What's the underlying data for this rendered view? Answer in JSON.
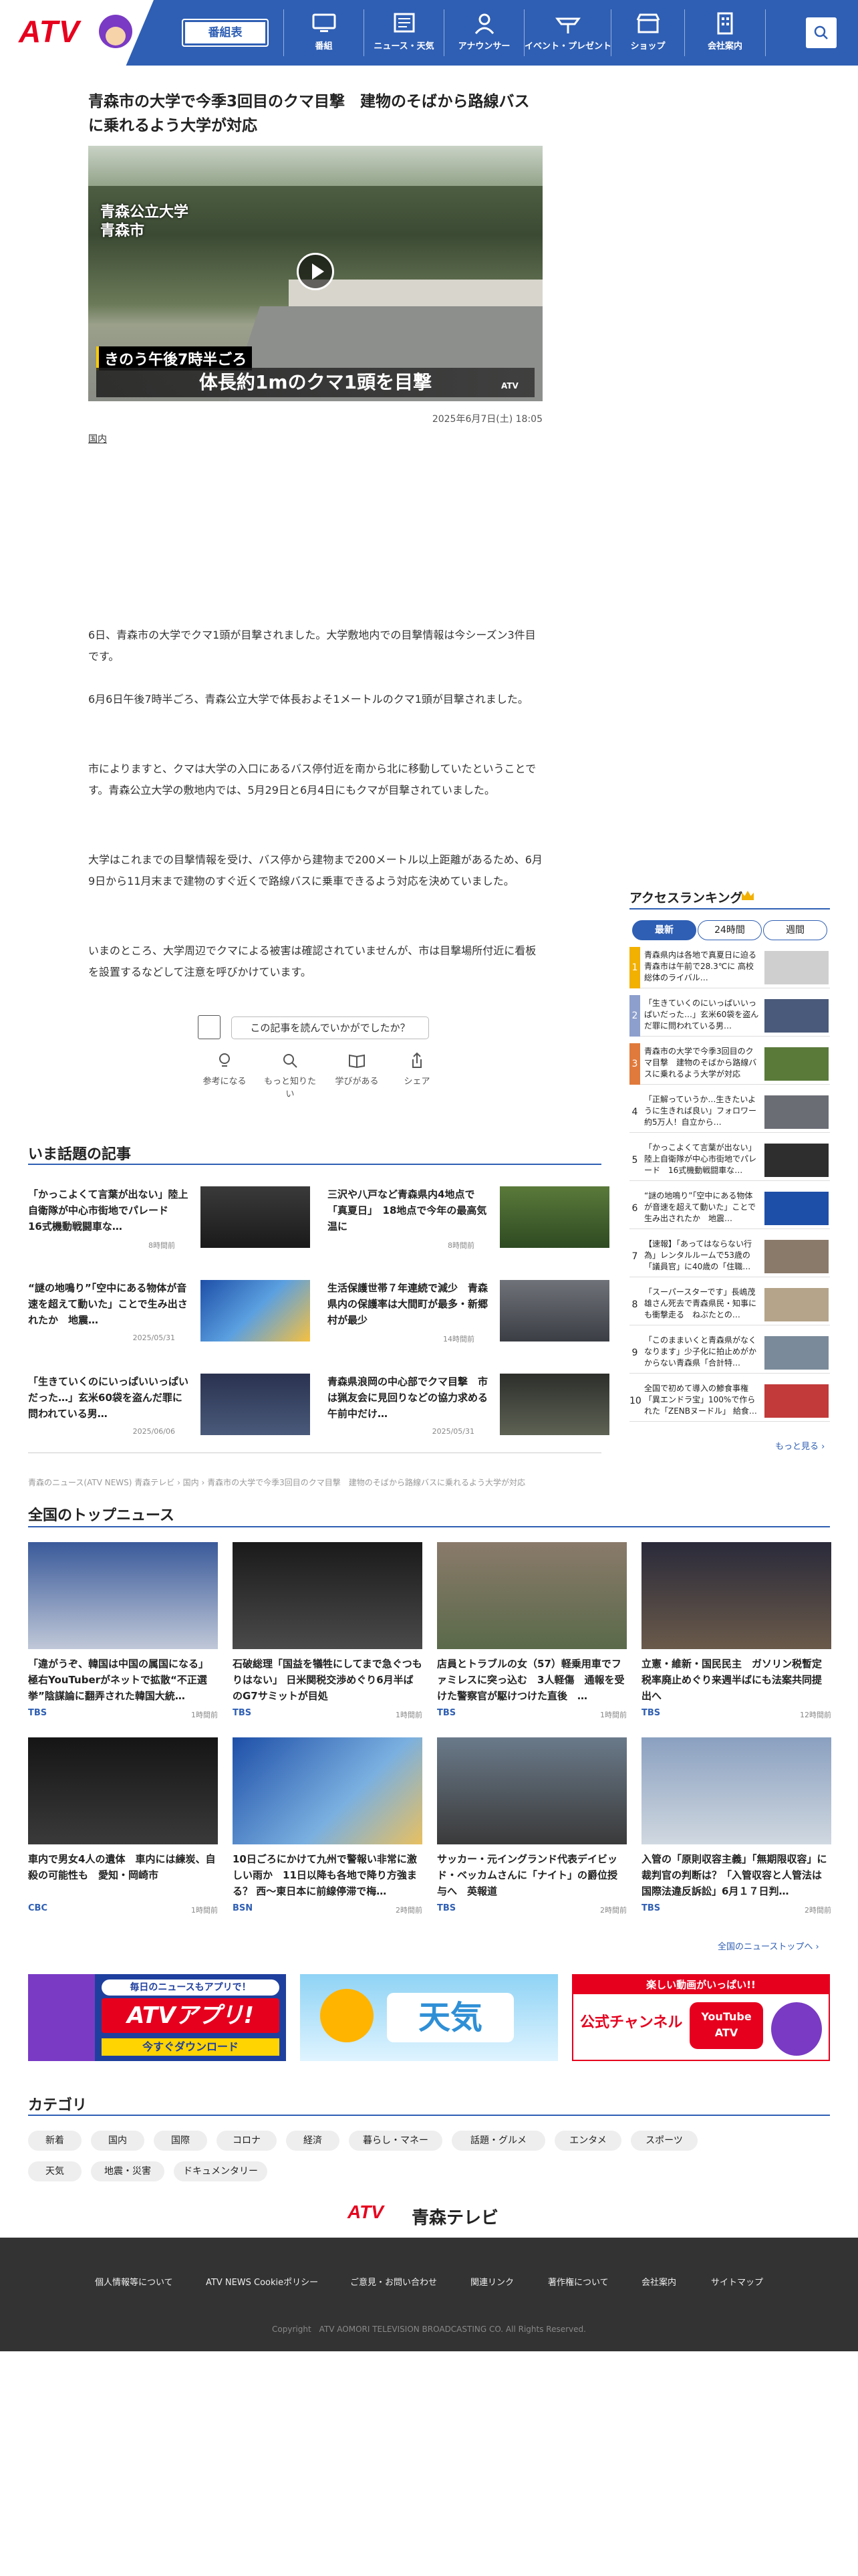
{
  "header": {
    "logo": "ATV",
    "bangumi": "番組表",
    "nav": [
      "番組",
      "ニュース・天気",
      "アナウンサー",
      "イベント・プレゼント",
      "ショップ",
      "会社案内"
    ]
  },
  "article": {
    "title": "青森市の大学で今季3回目のクマ目撃　建物のそばから路線バスに乗れるよう大学が対応",
    "video": {
      "location": "青森公立大学\n青森市",
      "caption_time": "きのう午後7時半ごろ",
      "caption_main": "体長約1mのクマ1頭を目撃",
      "bug": "ATV"
    },
    "date": "2025年6月7日(土) 18:05",
    "category": "国内",
    "paragraphs": [
      "6日、青森市の大学でクマ1頭が目撃されました。大学敷地内での目撃情報は今シーズン3件目です。",
      "6月6日午後7時半ごろ、青森公立大学で体長およそ1メートルのクマ1頭が目撃されました。",
      "市によりますと、クマは大学の入口にあるバス停付近を南から北に移動していたということです。青森公立大学の敷地内では、5月29日と6月4日にもクマが目撃されていました。",
      "大学はこれまでの目撃情報を受け、バス停から建物まで200メートル以上距離があるため、6月9日から11月末まで建物のすぐ近くで路線バスに乗車できるよう対応を決めていました。",
      "いまのところ、大学周辺でクマによる被害は確認されていませんが、市は目撃場所付近に看板を設置するなどして注意を呼びかけています。"
    ],
    "question": "この記事を読んでいかがでしたか？",
    "reactions": [
      "参考になる",
      "もっと知りたい",
      "学びがある",
      "シェア"
    ]
  },
  "trending": {
    "title": "いま話題の記事",
    "items": [
      {
        "title": "「かっこよくて言葉が出ない」陸上自衛隊が中心市街地でパレード　16式機動戦闘車な…",
        "time": "8時間前"
      },
      {
        "title": "三沢や八戸など青森県内4地点で「真夏日」　18地点で今年の最高気温に",
        "time": "8時間前"
      },
      {
        "title": "“謎の地鳴り”「空中にある物体が音速を超えて動いた」ことで生み出されたか　地震…",
        "time": "2025/05/31"
      },
      {
        "title": "生活保護世帯７年連続で減少　青森県内の保護率は大間町が最多・新郷村が最少",
        "time": "14時間前"
      },
      {
        "title": "「生きていくのにいっぱいいっぱいだった…」玄米60袋を盗んだ罪に問われている男…",
        "time": "2025/06/06"
      },
      {
        "title": "青森県浪岡の中心部でクマ目撃　市は猟友会に見回りなどの協力求める　午前中だけ…",
        "time": "2025/05/31"
      }
    ]
  },
  "breadcrumb": "青森のニュース(ATV NEWS) 青森テレビ › 国内 › 青森市の大学で今季3回目のクマ目撃　建物のそばから路線バスに乗れるよう大学が対応",
  "ranking": {
    "title": "アクセスランキング",
    "tabs": [
      "最新",
      "24時間",
      "週間"
    ],
    "items": [
      "青森県内は各地で真夏日に迫る　青森市は午前で28.3℃に 高校総体のライバル…",
      "「生きていくのにいっぱいいっぱいだった…」玄米60袋を盗んだ罪に問われている男…",
      "青森市の大学で今季3回目のクマ目撃　建物のそばから路線バスに乗れるよう大学が対応",
      "「正解っていうか…生きたいように生きれば良い」フォロワー約5万人！自立から…",
      "「かっこよくて言葉が出ない」陸上自衛隊が中心市街地でパレード　16式機動戦闘車な…",
      "“謎の地鳴り”「空中にある物体が音速を超えて動いた」ことで生み出されたか　地震…",
      "【速報】「あってはならない行為」レンタルルームで53歳の「議員官」に40歳の「住職…",
      "「スーパースターです」長嶋茂雄さん死去で青森県民・知事にも衝撃走る　ねぶたとの…",
      "「このままいくと青森県がなくなります」少子化に拍止めがかからない青森県「合計特…",
      "全国で初めて導入の鯵食事権「異エンドラ宝」100%で作られた「ZENBヌードル」 給食…"
    ],
    "more": "もっと見る ›"
  },
  "top_news": {
    "title": "全国のトップニュース",
    "items": [
      {
        "title": "「違がうぞ、韓国は中国の属国になる」極右YouTuberがネットで拡散“不正選挙”陰謀論に翻弄された韓国大統…",
        "src": "TBS",
        "time": "1時間前"
      },
      {
        "title": "石破総理「国益を犠牲にしてまで急ぐつもりはない」 日米関税交渉めぐり6月半ばのG7サミットが目処",
        "src": "TBS",
        "time": "1時間前"
      },
      {
        "title": "店員とトラブルの女（57）軽乗用車でファミレスに突っ込む　3人軽傷　通報を受けた警察官が駆けつけた直後　…",
        "src": "TBS",
        "time": "1時間前"
      },
      {
        "title": "立憲・維新・国民民主　ガソリン税暫定税率廃止めぐり来週半ばにも法案共同提出へ",
        "src": "TBS",
        "time": "12時間前"
      },
      {
        "title": "車内で男女4人の遺体　車内には練炭、自殺の可能性も　愛知・岡崎市",
        "src": "CBC",
        "time": "1時間前"
      },
      {
        "title": "10日ごろにかけて九州で警報い非常に激しい雨か　11日以降も各地で降り方強まる？ 西〜東日本に前線停滞で梅…",
        "src": "BSN",
        "time": "2時間前"
      },
      {
        "title": "サッカー・元イングランド代表デイビッド・ベッカムさんに「ナイト」の爵位授与へ　英報道",
        "src": "TBS",
        "time": "2時間前"
      },
      {
        "title": "入管の「原則収容主義」「無期限収容」に裁判官の判断は？「入管収容と人管法は国際法違反訴訟」6月１７日判…",
        "src": "TBS",
        "time": "2時間前"
      }
    ],
    "more": "全国のニューストップへ ›"
  },
  "banners": [
    {
      "small": "毎日のニュースもアプリで！",
      "big": "ATVアプリ!",
      "btn": "今すぐダウンロード"
    },
    {
      "big": "天気"
    },
    {
      "small": "楽しい動画がいっぱい!!",
      "big": "公式チャンネル",
      "tube": "YouTube ATV"
    }
  ],
  "categories": {
    "title": "カテゴリ",
    "items": [
      "新着",
      "国内",
      "国際",
      "コロナ",
      "経済",
      "暮らし・マネー",
      "話題・グルメ",
      "エンタメ",
      "スポーツ",
      "天気",
      "地震・災害",
      "ドキュメンタリー"
    ]
  },
  "footer": {
    "logo": "ATV",
    "logo2": "青森テレビ",
    "links": [
      "個人情報等について",
      "ATV NEWS Cookieポリシー",
      "ご意見・お問い合わせ",
      "関連リンク",
      "著作権について",
      "会社案内",
      "サイトマップ"
    ],
    "copyright": "Copyright　ATV AOMORI TELEVISION BROADCASTING CO. All Rights Reserved."
  }
}
